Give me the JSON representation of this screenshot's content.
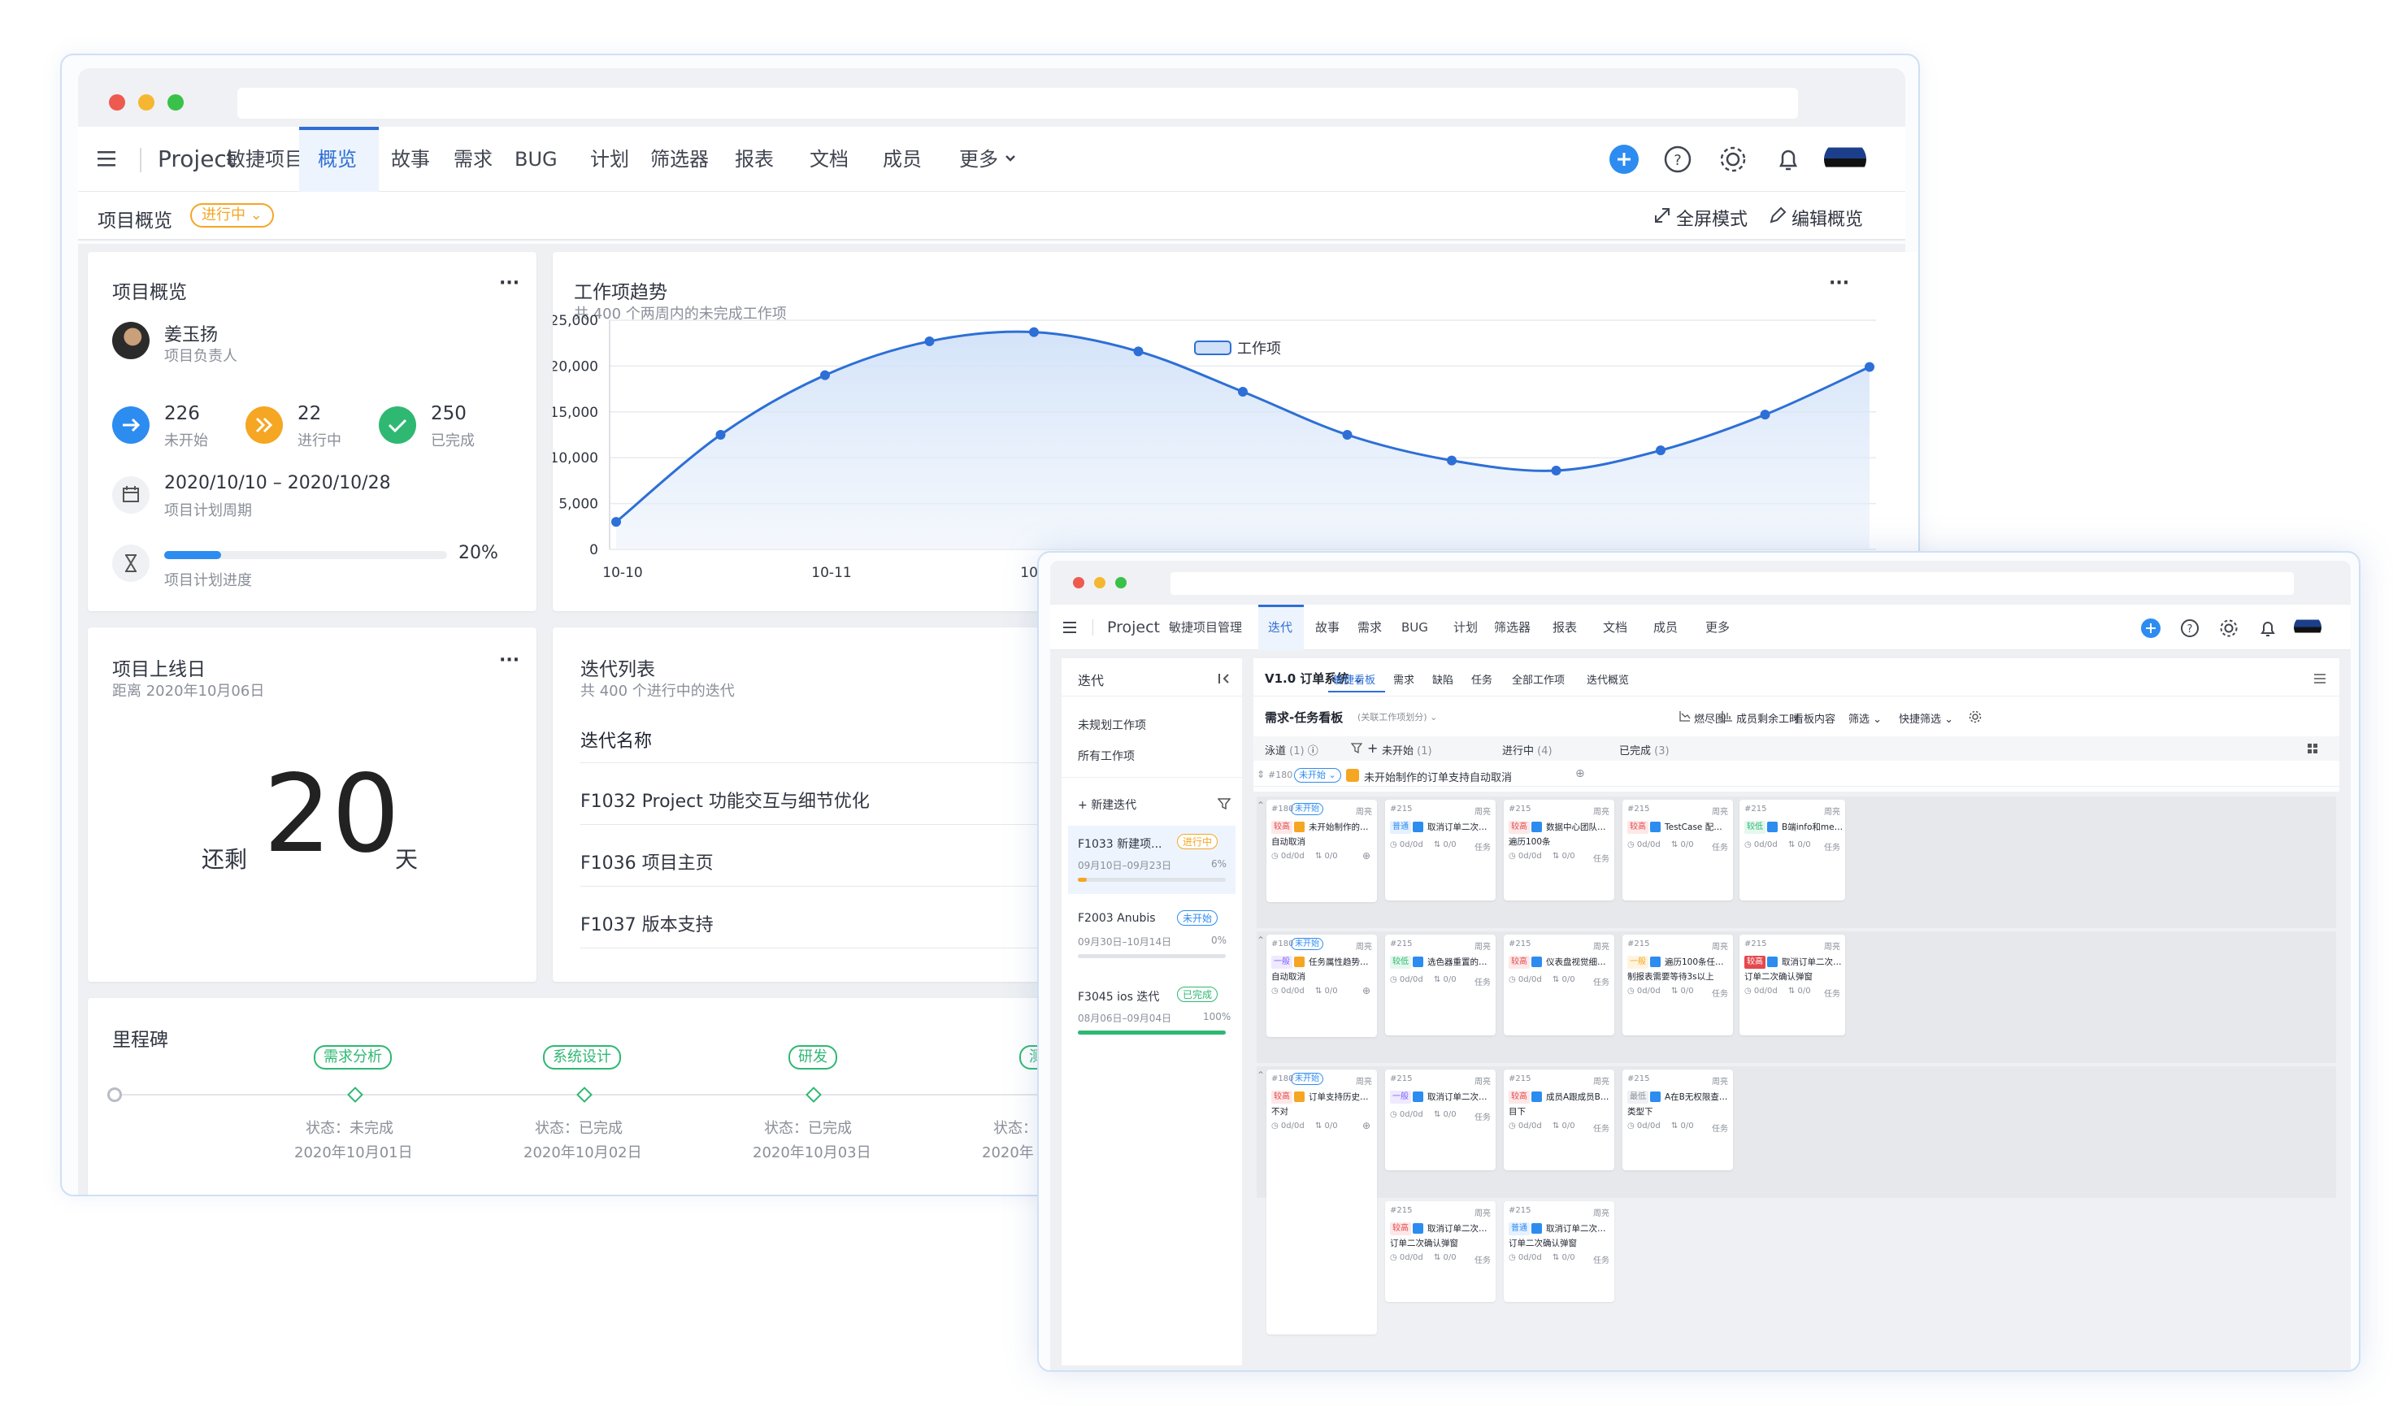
{
  "back": {
    "nav": {
      "project": "Project",
      "tabs": [
        "敏捷项目管理",
        "概览",
        "故事",
        "需求",
        "BUG",
        "计划",
        "筛选器",
        "报表",
        "文档",
        "成员",
        "更多"
      ],
      "active": "概览"
    },
    "subbar": {
      "title": "项目概览",
      "status": "进行中",
      "fullscreen": "全屏模式",
      "edit": "编辑概览"
    },
    "overview": {
      "title": "项目概览",
      "owner_name": "姜玉扬",
      "owner_role": "项目负责人",
      "stats": [
        {
          "value": "226",
          "label": "未开始",
          "color": "#2d8cf0"
        },
        {
          "value": "22",
          "label": "进行中",
          "color": "#f5a623"
        },
        {
          "value": "250",
          "label": "已完成",
          "color": "#2eb872"
        }
      ],
      "dates": "2020/10/10 – 2020/10/28",
      "dates_label": "项目计划周期",
      "progress": 0.2,
      "progress_text": "20%",
      "progress_label": "项目计划进度"
    },
    "trend": {
      "title": "工作项趋势",
      "subtitle": "共 400 个两周内的未完成工作项",
      "menu": "..."
    },
    "launch": {
      "title": "项目上线日",
      "subtitle": "距离 2020年10月06日",
      "prefix": "还剩",
      "days": "20",
      "suffix": "天"
    },
    "iterations": {
      "title": "迭代列表",
      "subtitle": "共 400 个进行中的迭代",
      "header": "迭代名称",
      "rows": [
        "F1032 Project 功能交互与细节优化",
        "F1036 项目主页",
        "F1037 版本支持"
      ]
    },
    "milestones": {
      "title": "里程碑",
      "items": [
        {
          "name": "需求分析",
          "status": "状态：未完成",
          "date": "2020年10月01日"
        },
        {
          "name": "系统设计",
          "status": "状态：已完成",
          "date": "2020年10月02日"
        },
        {
          "name": "研发",
          "status": "状态：已完成",
          "date": "2020年10月03日"
        },
        {
          "name": "测",
          "status": "状态：",
          "date": "2020年"
        }
      ]
    }
  },
  "chart_data": {
    "type": "area",
    "legend": "工作项",
    "x": [
      "10-10",
      "10-10.5",
      "10-11",
      "10-11.5",
      "10-12",
      "10-12.5",
      "10-13",
      "10-13.5",
      "10-14",
      "10-14.5",
      "10-15",
      "10-15.5",
      "10-16"
    ],
    "tick_labels": [
      "10-10",
      "10-11",
      "10-12",
      "10-13"
    ],
    "values": [
      3000,
      12500,
      19000,
      22700,
      23700,
      21600,
      17200,
      12500,
      9700,
      8600,
      10800,
      14700,
      19900
    ],
    "yticks": [
      "25,000",
      "20,000",
      "15,000",
      "10,000",
      "5,000",
      "0"
    ],
    "ylim": [
      0,
      25000
    ],
    "color": "#2d6fd6"
  },
  "front": {
    "nav": {
      "project": "Project",
      "tabs": [
        "敏捷项目管理",
        "迭代",
        "故事",
        "需求",
        "BUG",
        "计划",
        "筛选器",
        "报表",
        "文档",
        "成员",
        "更多"
      ],
      "active": "迭代"
    },
    "sidebar": {
      "title": "迭代",
      "links": [
        "未规划工作项",
        "所有工作项"
      ],
      "new": "新建迭代",
      "items": [
        {
          "name": "F1033 新建项...",
          "status": "进行中",
          "dates": "09月10日–09月23日",
          "pct": "6%",
          "progress": 0.06,
          "color": "#f5a623"
        },
        {
          "name": "F2003 Anubis",
          "status": "未开始",
          "dates": "09月30日–10月14日",
          "pct": "0%",
          "progress": 0,
          "color": "#2d8cf0"
        },
        {
          "name": "F3045 ios 迭代",
          "status": "已完成",
          "dates": "08月06日–09月04日",
          "pct": "100%",
          "progress": 1,
          "color": "#2eb872"
        }
      ]
    },
    "toolbar": {
      "version": "V1.0 订单系统",
      "tabs": [
        "敏捷看板",
        "需求",
        "缺陷",
        "任务",
        "全部工作项",
        "迭代概览"
      ],
      "active": "敏捷看板"
    },
    "board": {
      "title": "需求-任务看板",
      "hint": "(关联工作项划分)",
      "burn": "燃尽图",
      "hours": "成员剩余工时",
      "content": "看板内容",
      "filter": "筛选",
      "quick": "快捷筛选",
      "columns": [
        {
          "name": "泳道",
          "count": "(1)"
        },
        {
          "name": "未开始",
          "count": "(1)"
        },
        {
          "name": "进行中",
          "count": "(4)"
        },
        {
          "name": "已完成",
          "count": "(3)"
        }
      ],
      "lane": {
        "id": "#180",
        "status": "未开始",
        "title": "未开始制作的订单支持自动取消"
      }
    },
    "rows": [
      [
        {
          "id": "#180",
          "owner": "周亮",
          "status": "未开始",
          "pri": "较高",
          "pc": "#e5484d",
          "pb": "#fde8e8",
          "title": "未开始制作的订单支持–",
          "title2": "自动取消",
          "stat": "0d/0d",
          "sub": "0/0",
          "type": "story"
        },
        {
          "id": "#215",
          "owner": "周亮",
          "pri": "普通",
          "pc": "#2d8cf0",
          "pb": "#e6f1ff",
          "title": "取消订单二次确认弹窗",
          "stat": "0d/0d",
          "sub": "0/0",
          "type": "任务"
        },
        {
          "id": "#215",
          "owner": "周亮",
          "pri": "较高",
          "pc": "#e5484d",
          "pb": "#fde8e8",
          "title": "数据中心团队工时报表中",
          "title2": "遍历100条",
          "stat": "0d/0d",
          "sub": "0/0",
          "type": "任务"
        },
        {
          "id": "#215",
          "owner": "周亮",
          "pri": "较高",
          "pc": "#e5484d",
          "pb": "#fde8e8",
          "title": "TestCase 配置中心",
          "stat": "0d/0d",
          "sub": "0/0",
          "type": "任务"
        },
        {
          "id": "#215",
          "owner": "周亮",
          "pri": "较低",
          "pc": "#2eb872",
          "pb": "#e5f7ee",
          "title": "B端info和messa",
          "stat": "0d/0d",
          "sub": "0/0",
          "type": "任务"
        }
      ],
      [
        {
          "id": "#180",
          "owner": "周亮",
          "status": "未开始",
          "pri": "一般",
          "pc": "#7d5fff",
          "pb": "#efeaff",
          "title": "任务属性趋势报表加上,",
          "title2": "自动取消",
          "stat": "0d/0d",
          "sub": "0/0",
          "type": "story"
        },
        {
          "id": "#215",
          "owner": "周亮",
          "pri": "较低",
          "pc": "#2eb872",
          "pb": "#e5f7ee",
          "title": "选色器重置的样式",
          "stat": "0d/0d",
          "sub": "0/0",
          "type": "任务"
        },
        {
          "id": "#215",
          "owner": "周亮",
          "pri": "较高",
          "pc": "#e5484d",
          "pb": "#fde8e8",
          "title": "仪表盘视觉细节优化",
          "stat": "0d/0d",
          "sub": "0/0",
          "type": "任务"
        },
        {
          "id": "#215",
          "owner": "周亮",
          "pri": "一般",
          "pc": "#f5a623",
          "pb": "#fff4e0",
          "title": "遍历100条任务时预览预",
          "title2": "制报表需要等待3s以上",
          "stat": "0d/0d",
          "sub": "0/0",
          "type": "任务"
        },
        {
          "id": "#215",
          "owner": "周亮",
          "pri": "较高",
          "pc": "#ffffff",
          "pb": "#e5484d",
          "title": "取消订单二次确认",
          "title2": "订单二次确认弹窗",
          "stat": "0d/0d",
          "sub": "0/0",
          "type": "任务"
        }
      ],
      [
        {
          "id": "#180",
          "owner": "周亮",
          "status": "未开始",
          "pri": "较高",
          "pc": "#e5484d",
          "pb": "#fde8e8",
          "title": "订单支持历史的任务数量",
          "title2": "不对",
          "stat": "0d/0d",
          "sub": "0/0",
          "type": "story"
        },
        {
          "id": "#215",
          "owner": "周亮",
          "pri": "一般",
          "pc": "#7d5fff",
          "pb": "#efeaff",
          "title": "取消订单二次确认弹窗",
          "stat": "0d/0d",
          "sub": "0/0",
          "type": "任务"
        },
        {
          "id": "#215",
          "owner": "周亮",
          "pri": "较高",
          "pc": "#e5484d",
          "pb": "#fde8e8",
          "title": "成员A跟成员B在同一项",
          "title2": "目下",
          "stat": "0d/0d",
          "sub": "0/0",
          "type": "任务"
        },
        {
          "id": "#215",
          "owner": "周亮",
          "pri": "最低",
          "pc": "#8a8f99",
          "pb": "#f0f1f4",
          "title": "A在B无权限查看的任务",
          "title2": "类型下",
          "stat": "0d/0d",
          "sub": "0/0",
          "type": "任务"
        }
      ],
      [
        {
          "id": "#215",
          "owner": "周亮",
          "pri": "较高",
          "pc": "#e5484d",
          "pb": "#fde8e8",
          "title": "取消订单二次确认弹窗–",
          "title2": "订单二次确认弹窗",
          "stat": "0d/0d",
          "sub": "0/0",
          "type": "任务"
        },
        {
          "id": "#215",
          "owner": "周亮",
          "pri": "普通",
          "pc": "#2d8cf0",
          "pb": "#e6f1ff",
          "title": "取消订单二次确认弹窗–",
          "title2": "订单二次确认弹窗",
          "stat": "0d/0d",
          "sub": "0/0",
          "type": "任务"
        }
      ]
    ]
  }
}
